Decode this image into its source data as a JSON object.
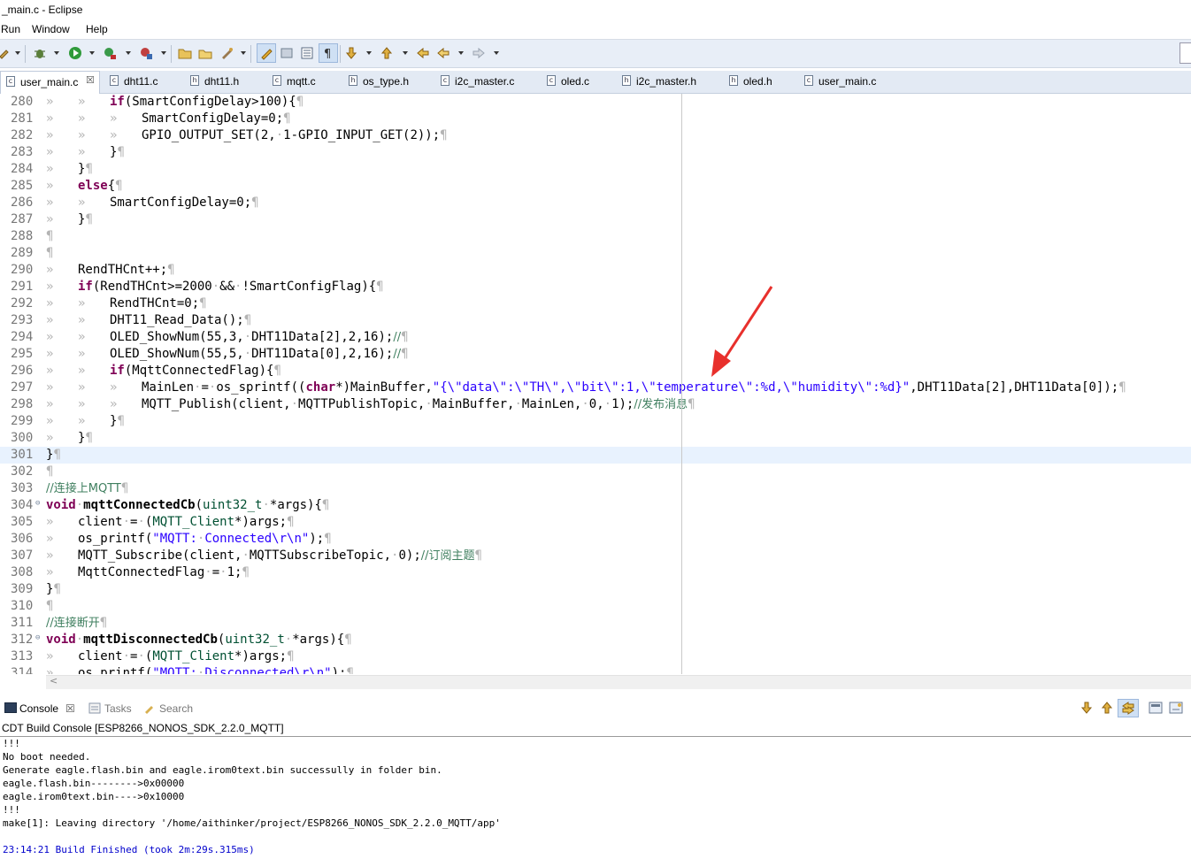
{
  "window": {
    "title": "_main.c - Eclipse"
  },
  "menu": [
    "Run",
    "Window",
    "Help"
  ],
  "tabs": [
    {
      "label": "user_main.c",
      "icon": "c-file-icon",
      "glyph": "c",
      "active": true,
      "closable": true
    },
    {
      "label": "dht11.c",
      "icon": "c-file-icon",
      "glyph": "c"
    },
    {
      "label": "dht11.h",
      "icon": "h-file-icon",
      "glyph": "h"
    },
    {
      "label": "mqtt.c",
      "icon": "c-file-icon",
      "glyph": "c"
    },
    {
      "label": "os_type.h",
      "icon": "h-file-icon",
      "glyph": "h"
    },
    {
      "label": "i2c_master.c",
      "icon": "c-file-icon",
      "glyph": "c"
    },
    {
      "label": "oled.c",
      "icon": "c-file-icon",
      "glyph": "c"
    },
    {
      "label": "i2c_master.h",
      "icon": "h-file-icon",
      "glyph": "h"
    },
    {
      "label": "oled.h",
      "icon": "h-file-icon",
      "glyph": "h"
    },
    {
      "label": "user_main.c",
      "icon": "c-file-icon",
      "glyph": "c"
    }
  ],
  "editor": {
    "lines": [
      {
        "n": "280",
        "html": "<span class=\"ws\">»&#9;»&#9;</span><span class=\"kw\">if</span>(SmartConfigDelay&gt;100){<span class=\"ws\">¶</span>"
      },
      {
        "n": "281",
        "html": "<span class=\"ws\">»&#9;»&#9;»&#9;</span>SmartConfigDelay=0;<span class=\"ws\">¶</span>"
      },
      {
        "n": "282",
        "html": "<span class=\"ws\">»&#9;»&#9;»&#9;</span>GPIO_OUTPUT_SET(2,<span class=\"ws\">·</span>1-GPIO_INPUT_GET(2));<span class=\"ws\">¶</span>"
      },
      {
        "n": "283",
        "html": "<span class=\"ws\">»&#9;»&#9;</span>}<span class=\"ws\">¶</span>"
      },
      {
        "n": "284",
        "html": "<span class=\"ws\">»&#9;</span>}<span class=\"ws\">¶</span>"
      },
      {
        "n": "285",
        "html": "<span class=\"ws\">»&#9;</span><span class=\"kw\">else</span>{<span class=\"ws\">¶</span>"
      },
      {
        "n": "286",
        "html": "<span class=\"ws\">»&#9;»&#9;</span>SmartConfigDelay=0;<span class=\"ws\">¶</span>"
      },
      {
        "n": "287",
        "html": "<span class=\"ws\">»&#9;</span>}<span class=\"ws\">¶</span>"
      },
      {
        "n": "288",
        "html": "<span class=\"ws\">¶</span>"
      },
      {
        "n": "289",
        "html": "<span class=\"ws\">¶</span>"
      },
      {
        "n": "290",
        "html": "<span class=\"ws\">»&#9;</span>RendTHCnt++;<span class=\"ws\">¶</span>"
      },
      {
        "n": "291",
        "html": "<span class=\"ws\">»&#9;</span><span class=\"kw\">if</span>(RendTHCnt&gt;=2000<span class=\"ws\">·</span>&amp;&amp;<span class=\"ws\">·</span>!SmartConfigFlag){<span class=\"ws\">¶</span>"
      },
      {
        "n": "292",
        "html": "<span class=\"ws\">»&#9;»&#9;</span>RendTHCnt=0;<span class=\"ws\">¶</span>"
      },
      {
        "n": "293",
        "html": "<span class=\"ws\">»&#9;»&#9;</span>DHT11_Read_Data();<span class=\"ws\">¶</span>"
      },
      {
        "n": "294",
        "html": "<span class=\"ws\">»&#9;»&#9;</span>OLED_ShowNum(55,3,<span class=\"ws\">·</span>DHT11Data[2],2,16);<span class=\"cm\">//</span><span class=\"ws\">¶</span>"
      },
      {
        "n": "295",
        "html": "<span class=\"ws\">»&#9;»&#9;</span>OLED_ShowNum(55,5,<span class=\"ws\">·</span>DHT11Data[0],2,16);<span class=\"cm\">//</span><span class=\"ws\">¶</span>"
      },
      {
        "n": "296",
        "html": "<span class=\"ws\">»&#9;»&#9;</span><span class=\"kw\">if</span>(MqttConnectedFlag){<span class=\"ws\">¶</span>"
      },
      {
        "n": "297",
        "html": "<span class=\"ws\">»&#9;»&#9;»&#9;</span>MainLen<span class=\"ws\">·</span>=<span class=\"ws\">·</span>os_sprintf((<span class=\"kw\">char</span>*)MainBuffer,<span class=\"str\">\"{\\\"data\\\":\\\"TH\\\",\\\"bit\\\":1,\\\"temperature\\\":%d,\\\"humidity\\\":%d}\"</span>,DHT11Data[2],DHT11Data[0]);<span class=\"ws\">¶</span>"
      },
      {
        "n": "298",
        "html": "<span class=\"ws\">»&#9;»&#9;»&#9;</span>MQTT_Publish(client,<span class=\"ws\">·</span>MQTTPublishTopic,<span class=\"ws\">·</span>MainBuffer,<span class=\"ws\">·</span>MainLen,<span class=\"ws\">·</span>0,<span class=\"ws\">·</span>1);<span class=\"cm\">//发布消息</span><span class=\"ws\">¶</span>"
      },
      {
        "n": "299",
        "html": "<span class=\"ws\">»&#9;»&#9;</span>}<span class=\"ws\">¶</span>"
      },
      {
        "n": "300",
        "html": "<span class=\"ws\">»&#9;</span>}<span class=\"ws\">¶</span>"
      },
      {
        "n": "301",
        "html": "}<span class=\"ws\">¶</span>",
        "current": true
      },
      {
        "n": "302",
        "html": "<span class=\"ws\">¶</span>"
      },
      {
        "n": "303",
        "html": "<span class=\"cm\">//连接上MQTT</span><span class=\"ws\">¶</span>"
      },
      {
        "n": "304",
        "html": "<span class=\"kw\">void</span><span class=\"ws\">·</span><span class=\"bold\">mqttConnectedCb</span>(<span class=\"ty\">uint32_t</span><span class=\"ws\">·</span>*args){<span class=\"ws\">¶</span>",
        "fold": true
      },
      {
        "n": "305",
        "html": "<span class=\"ws\">»&#9;</span>client<span class=\"ws\">·</span>=<span class=\"ws\">·</span>(<span class=\"ty\">MQTT_Client</span>*)args;<span class=\"ws\">¶</span>"
      },
      {
        "n": "306",
        "html": "<span class=\"ws\">»&#9;</span>os_printf(<span class=\"str\">\"MQTT:<span class=\"ws\">·</span>Connected\\r\\n\"</span>);<span class=\"ws\">¶</span>"
      },
      {
        "n": "307",
        "html": "<span class=\"ws\">»&#9;</span>MQTT_Subscribe(client,<span class=\"ws\">·</span>MQTTSubscribeTopic,<span class=\"ws\">·</span>0);<span class=\"cm\">//订阅主题</span><span class=\"ws\">¶</span>"
      },
      {
        "n": "308",
        "html": "<span class=\"ws\">»&#9;</span>MqttConnectedFlag<span class=\"ws\">·</span>=<span class=\"ws\">·</span>1;<span class=\"ws\">¶</span>"
      },
      {
        "n": "309",
        "html": "}<span class=\"ws\">¶</span>"
      },
      {
        "n": "310",
        "html": "<span class=\"ws\">¶</span>"
      },
      {
        "n": "311",
        "html": "<span class=\"cm\">//连接断开</span><span class=\"ws\">¶</span>"
      },
      {
        "n": "312",
        "html": "<span class=\"kw\">void</span><span class=\"ws\">·</span><span class=\"bold\">mqttDisconnectedCb</span>(<span class=\"ty\">uint32_t</span><span class=\"ws\">·</span>*args){<span class=\"ws\">¶</span>",
        "fold": true
      },
      {
        "n": "313",
        "html": "<span class=\"ws\">»&#9;</span>client<span class=\"ws\">·</span>=<span class=\"ws\">·</span>(<span class=\"ty\">MQTT_Client</span>*)args;<span class=\"ws\">¶</span>"
      },
      {
        "n": "314",
        "html": "<span class=\"ws\">»&#9;</span>os_printf(<span class=\"str\">\"MQTT:<span class=\"ws\">·</span>Disconnected\\r\\n\"</span>);<span class=\"ws\">¶</span>"
      }
    ]
  },
  "annotation": {
    "color": "#e8302c"
  },
  "console": {
    "tabs": [
      {
        "label": "Console",
        "icon": "console-icon",
        "active": true
      },
      {
        "label": "Tasks",
        "icon": "tasks-icon"
      },
      {
        "label": "Search",
        "icon": "search-icon"
      }
    ],
    "title": "CDT Build Console [ESP8266_NONOS_SDK_2.2.0_MQTT]",
    "lines": [
      "!!!",
      "No boot needed.",
      "Generate eagle.flash.bin and eagle.irom0text.bin successully in folder bin.",
      "eagle.flash.bin-------->0x00000",
      "eagle.irom0text.bin---->0x10000",
      "!!!",
      "make[1]: Leaving directory '/home/aithinker/project/ESP8266_NONOS_SDK_2.2.0_MQTT/app'",
      "",
      "23:14:21 Build Finished (took 2m:29s.315ms)"
    ]
  }
}
